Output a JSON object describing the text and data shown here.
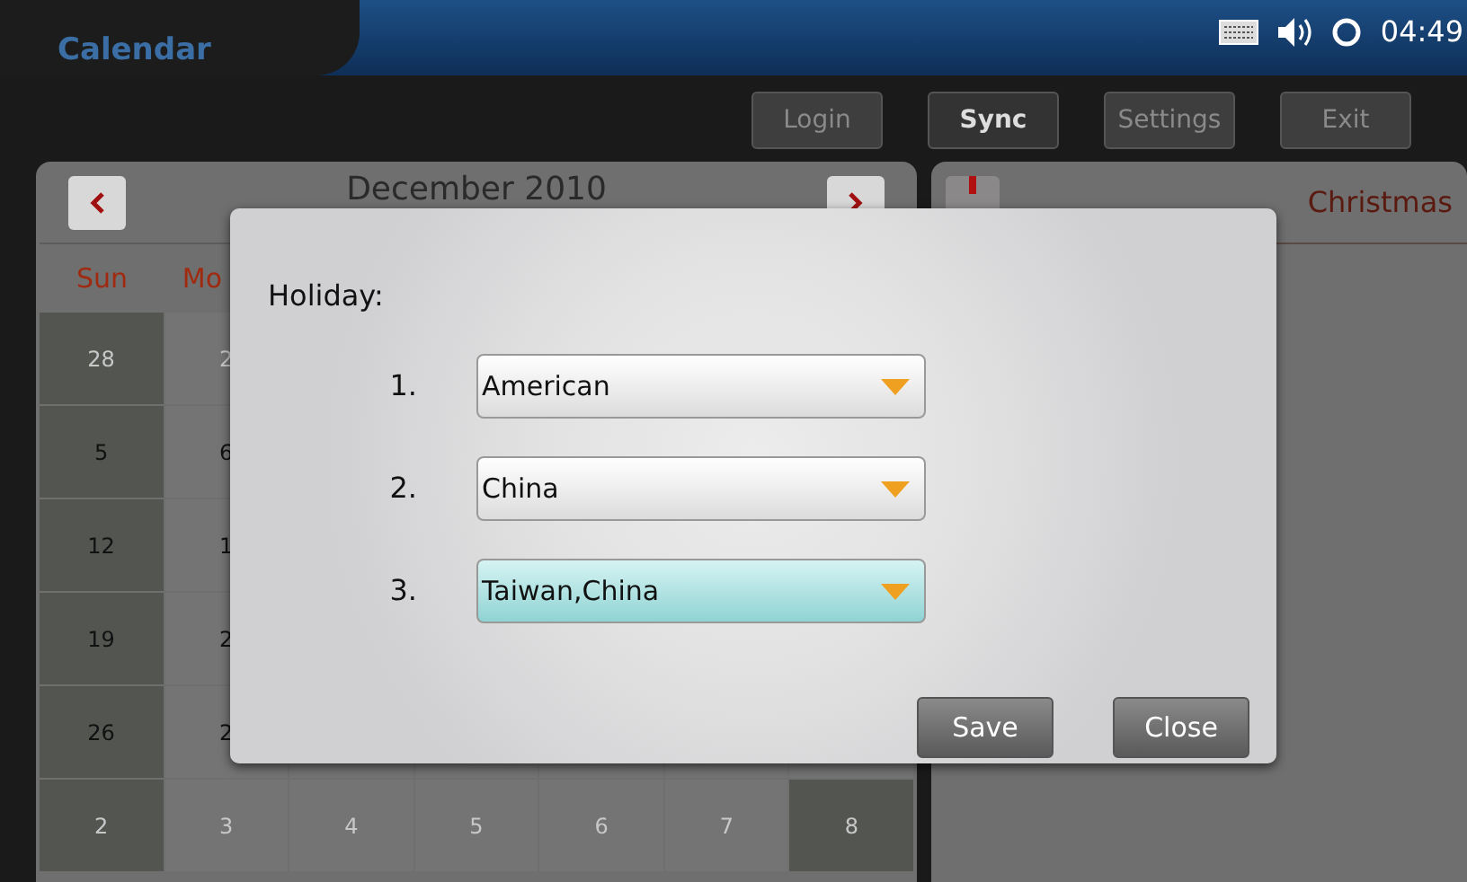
{
  "top_bar": {
    "app_title": "Calendar",
    "time": "04:49"
  },
  "toolbar": [
    {
      "label": "Login",
      "selected": false
    },
    {
      "label": "Sync",
      "selected": true
    },
    {
      "label": "Settings",
      "selected": false
    },
    {
      "label": "Exit",
      "selected": false
    }
  ],
  "calendar": {
    "month_title": "December 2010",
    "day_headers": [
      "Sun",
      "Mo"
    ],
    "rows": [
      [
        {
          "text": "28",
          "weekend": true,
          "other_month": true
        },
        {
          "text": "2",
          "weekend": false,
          "other_month": true
        }
      ],
      [
        {
          "text": "5",
          "weekend": true,
          "other_month": false
        },
        {
          "text": "6",
          "weekend": false,
          "other_month": false
        }
      ],
      [
        {
          "text": "12",
          "weekend": true,
          "other_month": false
        },
        {
          "text": "1",
          "weekend": false,
          "other_month": false
        }
      ],
      [
        {
          "text": "19",
          "weekend": true,
          "other_month": false
        },
        {
          "text": "2",
          "weekend": false,
          "other_month": false
        }
      ],
      [
        {
          "text": "26",
          "weekend": true,
          "other_month": false
        },
        {
          "text": "2",
          "weekend": false,
          "other_month": false
        }
      ],
      [
        {
          "text": "2",
          "weekend": true,
          "other_month": true
        },
        {
          "text": "3",
          "weekend": false,
          "other_month": true
        },
        {
          "text": "4",
          "weekend": false,
          "other_month": true
        },
        {
          "text": "5",
          "weekend": false,
          "other_month": true
        },
        {
          "text": "6",
          "weekend": false,
          "other_month": true
        },
        {
          "text": "7",
          "weekend": false,
          "other_month": true
        },
        {
          "text": "8",
          "weekend": true,
          "other_month": true
        }
      ]
    ]
  },
  "event_panel": {
    "title": "Christmas"
  },
  "dialog": {
    "label": "Holiday:",
    "holidays": [
      {
        "number": "1.",
        "value": "American",
        "selected": false
      },
      {
        "number": "2.",
        "value": "China",
        "selected": false
      },
      {
        "number": "3.",
        "value": "Taiwan,China",
        "selected": true
      }
    ],
    "buttons": [
      "Save",
      "Close"
    ]
  }
}
